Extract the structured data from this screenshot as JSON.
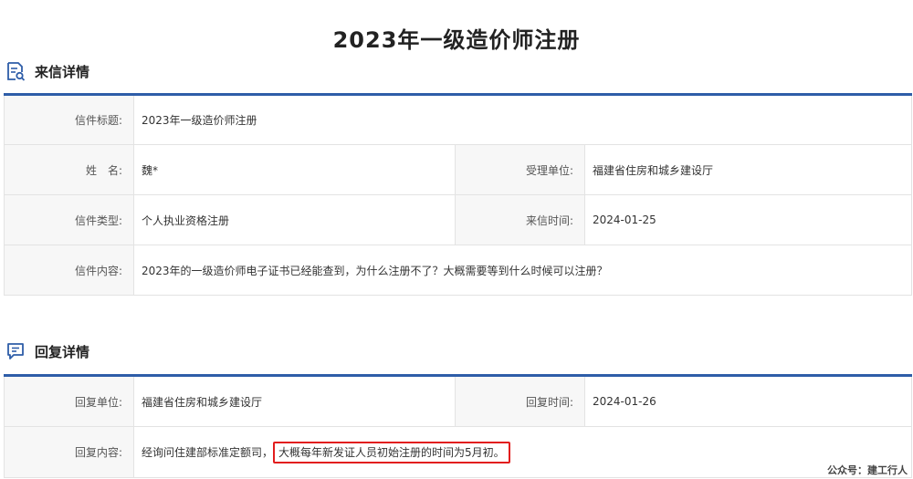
{
  "page": {
    "title": "2023年一级造价师注册"
  },
  "letter": {
    "section_title": "来信详情",
    "subject_label": "信件标题:",
    "subject_value": "2023年一级造价师注册",
    "name_label": "姓　名:",
    "name_value": "魏*",
    "unit_label": "受理单位:",
    "unit_value": "福建省住房和城乡建设厅",
    "type_label": "信件类型:",
    "type_value": "个人执业资格注册",
    "time_label": "来信时间:",
    "time_value": "2024-01-25",
    "content_label": "信件内容:",
    "content_value": "2023年的一级造价师电子证书已经能查到，为什么注册不了？大概需要等到什么时候可以注册？"
  },
  "reply": {
    "section_title": "回复详情",
    "unit_label": "回复单位:",
    "unit_value": "福建省住房和城乡建设厅",
    "time_label": "回复时间:",
    "time_value": "2024-01-26",
    "content_label": "回复内容:",
    "content_prefix": "经询问住建部标准定额司，",
    "content_highlight": "大概每年新发证人员初始注册的时间为5月初。"
  },
  "watermark": "公众号：建工行人",
  "colors": {
    "accent_blue": "#2e5da8",
    "highlight_red": "#e21d1d"
  },
  "icons": {
    "letter_section": "document-search-icon",
    "reply_section": "chat-bubble-icon"
  }
}
